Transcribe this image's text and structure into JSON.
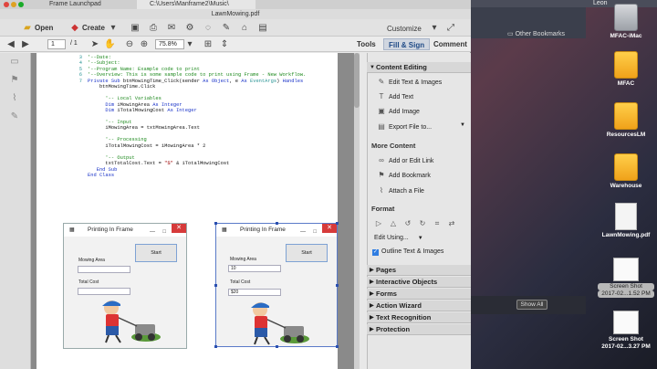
{
  "desktop": {
    "user": "Leon",
    "other_bookmarks": "Other Bookmarks",
    "show_all": "Show All",
    "icons": [
      {
        "label": "MFAC-iMac",
        "kind": "grey",
        "icon": "hard-drive-icon"
      },
      {
        "label": "MFAC",
        "kind": "drive",
        "icon": "external-drive-icon"
      },
      {
        "label": "ResourcesLM",
        "kind": "drive",
        "icon": "external-drive-icon"
      },
      {
        "label": "Warehouse",
        "kind": "drive",
        "icon": "external-drive-icon"
      },
      {
        "label": "LawnMowing.pdf",
        "kind": "doc",
        "icon": "pdf-file-icon"
      },
      {
        "label": "Screen Shot",
        "label2": "2017-02...1.52 PM",
        "kind": "shot",
        "icon": "screenshot-file-icon",
        "selected": true
      },
      {
        "label": "Screen Shot",
        "label2": "2017-02...3.27 PM",
        "kind": "shot",
        "icon": "screenshot-file-icon"
      }
    ]
  },
  "acrobat": {
    "tabs": [
      "Frame Launchpad",
      "C:\\Users\\Manframe2\\Music\\"
    ],
    "title": "LawnMowing.pdf",
    "toolbar": {
      "open": "Open",
      "create": "Create",
      "customize": "Customize"
    },
    "nav": {
      "page": "1",
      "total": "/ 1",
      "zoom": "75.8%"
    },
    "right_tabs": [
      "Tools",
      "Fill & Sign",
      "Comment"
    ],
    "panel": {
      "content_editing": "Content Editing",
      "edit_text_images": "Edit Text & Images",
      "add_text": "Add Text",
      "add_image": "Add Image",
      "export_file": "Export File to...",
      "more_content": "More Content",
      "add_edit_link": "Add or Edit Link",
      "add_bookmark": "Add Bookmark",
      "attach_file": "Attach a File",
      "format": "Format",
      "edit_using": "Edit Using...",
      "outline_text": "Outline Text & Images",
      "sections": [
        "Pages",
        "Interactive Objects",
        "Forms",
        "Action Wizard",
        "Text Recognition",
        "Protection"
      ]
    }
  },
  "code_lines": [
    {
      "n": "3",
      "parts": [
        {
          "c": "cm",
          "t": "'--Date:"
        }
      ]
    },
    {
      "n": "4",
      "parts": [
        {
          "c": "cm",
          "t": "'--Subject:"
        }
      ]
    },
    {
      "n": "5",
      "parts": [
        {
          "c": "cm",
          "t": "'--Program Name: Example code to print"
        }
      ]
    },
    {
      "n": "6",
      "parts": [
        {
          "c": "cm",
          "t": "'--Overview: This is some sample code to print using Frame - New Workflow."
        }
      ]
    },
    {
      "n": "7",
      "parts": [
        {
          "c": "kw",
          "t": "Private Sub "
        },
        {
          "c": "tx",
          "t": "btnMowingTime_Click(sender "
        },
        {
          "c": "kw",
          "t": "As Object"
        },
        {
          "c": "tx",
          "t": ", e "
        },
        {
          "c": "kw",
          "t": "As "
        },
        {
          "c": "ty",
          "t": "EventArgs"
        },
        {
          "c": "tx",
          "t": ") "
        },
        {
          "c": "kw",
          "t": "Handles"
        }
      ]
    },
    {
      "n": "",
      "parts": [
        {
          "c": "tx",
          "t": "    btnMowingTime.Click"
        }
      ]
    },
    {
      "n": "",
      "parts": [
        {
          "c": "tx",
          "t": ""
        }
      ]
    },
    {
      "n": "",
      "parts": [
        {
          "c": "cm",
          "t": "      '-- Local Variables"
        }
      ]
    },
    {
      "n": "",
      "parts": [
        {
          "c": "kw",
          "t": "      Dim "
        },
        {
          "c": "tx",
          "t": "iMowingArea "
        },
        {
          "c": "kw",
          "t": "As Integer"
        }
      ]
    },
    {
      "n": "",
      "parts": [
        {
          "c": "kw",
          "t": "      Dim "
        },
        {
          "c": "tx",
          "t": "iTotalMowingCost "
        },
        {
          "c": "kw",
          "t": "As Integer"
        }
      ]
    },
    {
      "n": "",
      "parts": [
        {
          "c": "tx",
          "t": ""
        }
      ]
    },
    {
      "n": "",
      "parts": [
        {
          "c": "cm",
          "t": "      '-- Input"
        }
      ]
    },
    {
      "n": "",
      "parts": [
        {
          "c": "tx",
          "t": "      iMowingArea = txtMowingArea.Text"
        }
      ]
    },
    {
      "n": "",
      "parts": [
        {
          "c": "tx",
          "t": ""
        }
      ]
    },
    {
      "n": "",
      "parts": [
        {
          "c": "cm",
          "t": "      '-- Processing"
        }
      ]
    },
    {
      "n": "",
      "parts": [
        {
          "c": "tx",
          "t": "      iTotalMowingCost = iMowingArea * 2"
        }
      ]
    },
    {
      "n": "",
      "parts": [
        {
          "c": "tx",
          "t": ""
        }
      ]
    },
    {
      "n": "",
      "parts": [
        {
          "c": "cm",
          "t": "      '-- Output"
        }
      ]
    },
    {
      "n": "",
      "parts": [
        {
          "c": "tx",
          "t": "      txtTotalCost.Text = "
        },
        {
          "c": "st",
          "t": "\"$\""
        },
        {
          "c": "tx",
          "t": " & iTotalMowingCost"
        }
      ]
    },
    {
      "n": "",
      "parts": [
        {
          "c": "kw",
          "t": "   End Sub"
        }
      ]
    },
    {
      "n": "",
      "parts": [
        {
          "c": "kw",
          "t": "End Class"
        }
      ]
    }
  ],
  "forms": [
    {
      "title": "Printing In Frame",
      "area_label": "Mowing Area",
      "area_value": "",
      "cost_label": "Total Cost",
      "cost_value": "",
      "button": "Start"
    },
    {
      "title": "Printing In Frame",
      "area_label": "Mowing Area",
      "area_value": "10",
      "cost_label": "Total Cost",
      "cost_value": "$20",
      "button": "Start"
    }
  ]
}
